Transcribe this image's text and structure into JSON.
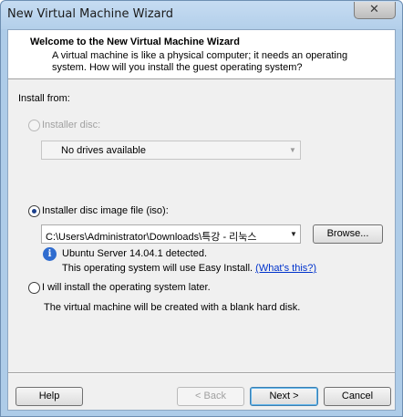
{
  "window": {
    "title": "New Virtual Machine Wizard",
    "close_glyph": "✕"
  },
  "header": {
    "title": "Welcome to the New Virtual Machine Wizard",
    "description": "A virtual machine is like a physical computer; it needs an operating system. How will you install the guest operating system?"
  },
  "install": {
    "label": "Install from:",
    "installer_disc": {
      "label": "Installer disc:",
      "selected": false,
      "enabled": false
    },
    "drives_combo": {
      "value": "No drives available",
      "enabled": false
    },
    "iso": {
      "label": "Installer disc image file (iso):",
      "selected": true,
      "path": "C:\\Users\\Administrator\\Downloads\\특강 - 리눅스",
      "browse_label": "Browse...",
      "detected_text": "Ubuntu Server 14.04.1 detected.",
      "easy_install_text": "This operating system will use Easy Install.",
      "whats_this_link": "(What's this?)"
    },
    "later": {
      "label": "I will install the operating system later.",
      "selected": false,
      "description": "The virtual machine will be created with a blank hard disk."
    }
  },
  "buttons": {
    "help": "Help",
    "back": "< Back",
    "next": "Next >",
    "cancel": "Cancel"
  },
  "colors": {
    "title_bar": "#b3cfea",
    "dialog_bg": "#f0f0f0",
    "link": "#0033cc",
    "radio_dot": "#1b3f8c"
  }
}
